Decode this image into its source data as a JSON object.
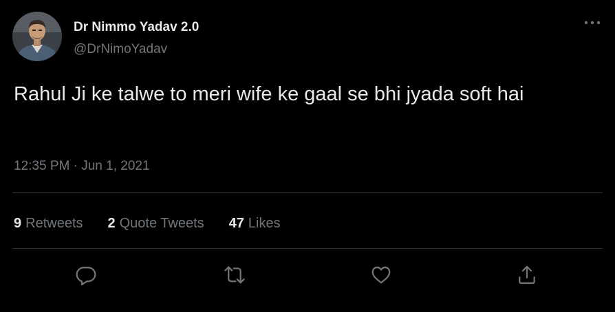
{
  "author": {
    "display_name": "Dr Nimmo Yadav 2.0",
    "handle": "@DrNimoYadav"
  },
  "tweet": {
    "text": "Rahul Ji ke talwe to meri wife ke gaal se bhi jyada soft hai",
    "time": "12:35 PM",
    "separator": "·",
    "date": "Jun 1, 2021"
  },
  "stats": {
    "retweets_count": "9",
    "retweets_label": "Retweets",
    "quotes_count": "2",
    "quotes_label": "Quote Tweets",
    "likes_count": "47",
    "likes_label": "Likes"
  },
  "icons": {
    "more": "more-horizontal-icon",
    "reply": "reply-icon",
    "retweet": "retweet-icon",
    "like": "heart-icon",
    "share": "share-icon"
  },
  "colors": {
    "background": "#000000",
    "primary_text": "#e7e9ea",
    "secondary_text": "#71767b",
    "divider": "#2f3336"
  }
}
